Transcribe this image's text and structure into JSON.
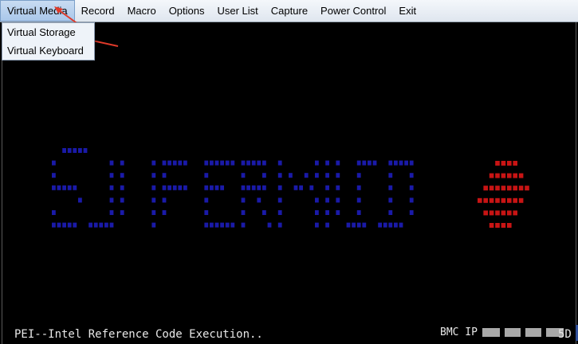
{
  "menu": {
    "items": [
      "Virtual Media",
      "Record",
      "Macro",
      "Options",
      "User List",
      "Capture",
      "Power Control",
      "Exit"
    ],
    "active": "Virtual Media"
  },
  "dropdown": {
    "items": [
      "Virtual Storage",
      "Virtual Keyboard"
    ]
  },
  "console": {
    "bmc_label": "BMC IP",
    "status_text": "PEI--Intel Reference Code Execution..",
    "post_code": "5D",
    "logo_colors": {
      "text": "#1a1aa8",
      "accent": "#c81414"
    }
  },
  "annotations": {
    "arrow_color": "#e03a2a"
  }
}
